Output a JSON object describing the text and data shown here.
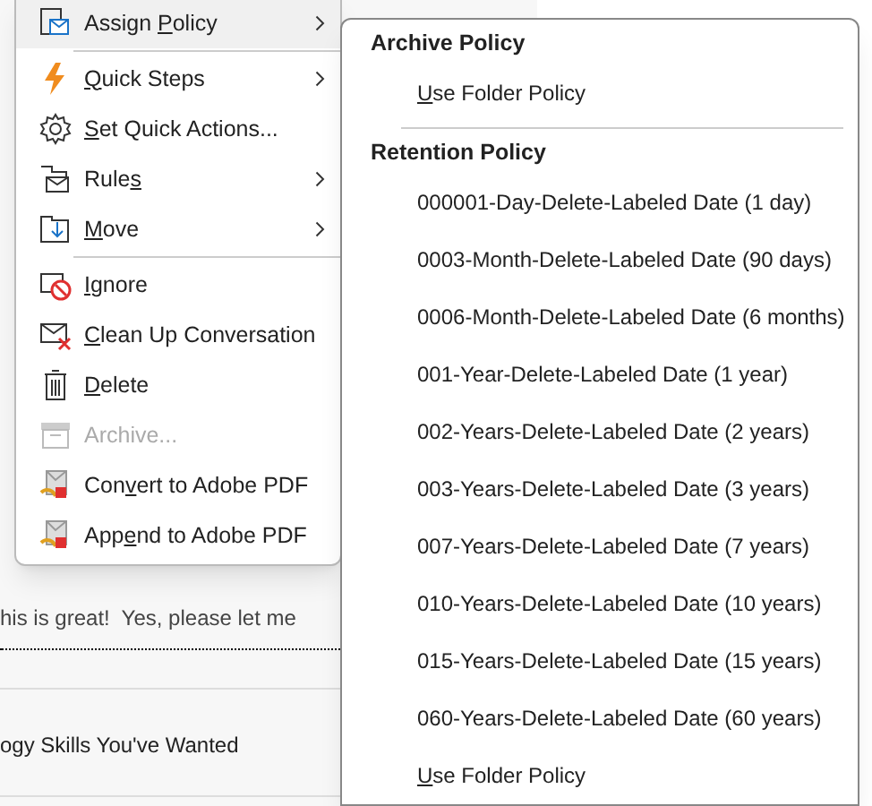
{
  "background": {
    "snippets": [
      "his is great!  Yes, please let me",
      "ogy Skills You've Wanted"
    ]
  },
  "context_menu": {
    "items": [
      {
        "kind": "item",
        "label": "Assign Policy",
        "submenu": true,
        "selected": true,
        "disabled": false
      },
      {
        "kind": "separator"
      },
      {
        "kind": "item",
        "label": "Quick Steps",
        "submenu": true,
        "selected": false,
        "disabled": false
      },
      {
        "kind": "item",
        "label": "Set Quick Actions...",
        "submenu": false,
        "selected": false,
        "disabled": false
      },
      {
        "kind": "item",
        "label": "Rules",
        "submenu": true,
        "selected": false,
        "disabled": false
      },
      {
        "kind": "item",
        "label": "Move",
        "submenu": true,
        "selected": false,
        "disabled": false
      },
      {
        "kind": "separator"
      },
      {
        "kind": "item",
        "label": "Ignore",
        "submenu": false,
        "selected": false,
        "disabled": false
      },
      {
        "kind": "item",
        "label": "Clean Up Conversation",
        "submenu": false,
        "selected": false,
        "disabled": false
      },
      {
        "kind": "item",
        "label": "Delete",
        "submenu": false,
        "selected": false,
        "disabled": false
      },
      {
        "kind": "item",
        "label": "Archive...",
        "submenu": false,
        "selected": false,
        "disabled": true
      },
      {
        "kind": "item",
        "label": "Convert to Adobe PDF",
        "submenu": false,
        "selected": false,
        "disabled": false
      },
      {
        "kind": "item",
        "label": "Append to Adobe PDF",
        "submenu": false,
        "selected": false,
        "disabled": false
      }
    ]
  },
  "submenu": {
    "items": [
      {
        "kind": "header",
        "label": "Archive Policy"
      },
      {
        "kind": "item",
        "label": "Use Folder Policy"
      },
      {
        "kind": "separator"
      },
      {
        "kind": "header",
        "label": "Retention Policy"
      },
      {
        "kind": "item",
        "label": "000001-Day-Delete-Labeled Date (1 day)"
      },
      {
        "kind": "item",
        "label": "0003-Month-Delete-Labeled Date (90 days)"
      },
      {
        "kind": "item",
        "label": "0006-Month-Delete-Labeled Date (6 months)"
      },
      {
        "kind": "item",
        "label": "001-Year-Delete-Labeled Date (1 year)"
      },
      {
        "kind": "item",
        "label": "002-Years-Delete-Labeled Date (2 years)"
      },
      {
        "kind": "item",
        "label": "003-Years-Delete-Labeled Date (3 years)"
      },
      {
        "kind": "item",
        "label": "007-Years-Delete-Labeled Date (7 years)"
      },
      {
        "kind": "item",
        "label": "010-Years-Delete-Labeled Date (10 years)"
      },
      {
        "kind": "item",
        "label": "015-Years-Delete-Labeled Date (15 years)"
      },
      {
        "kind": "item",
        "label": "060-Years-Delete-Labeled Date (60 years)"
      },
      {
        "kind": "item",
        "label": "Use Folder Policy"
      }
    ]
  }
}
